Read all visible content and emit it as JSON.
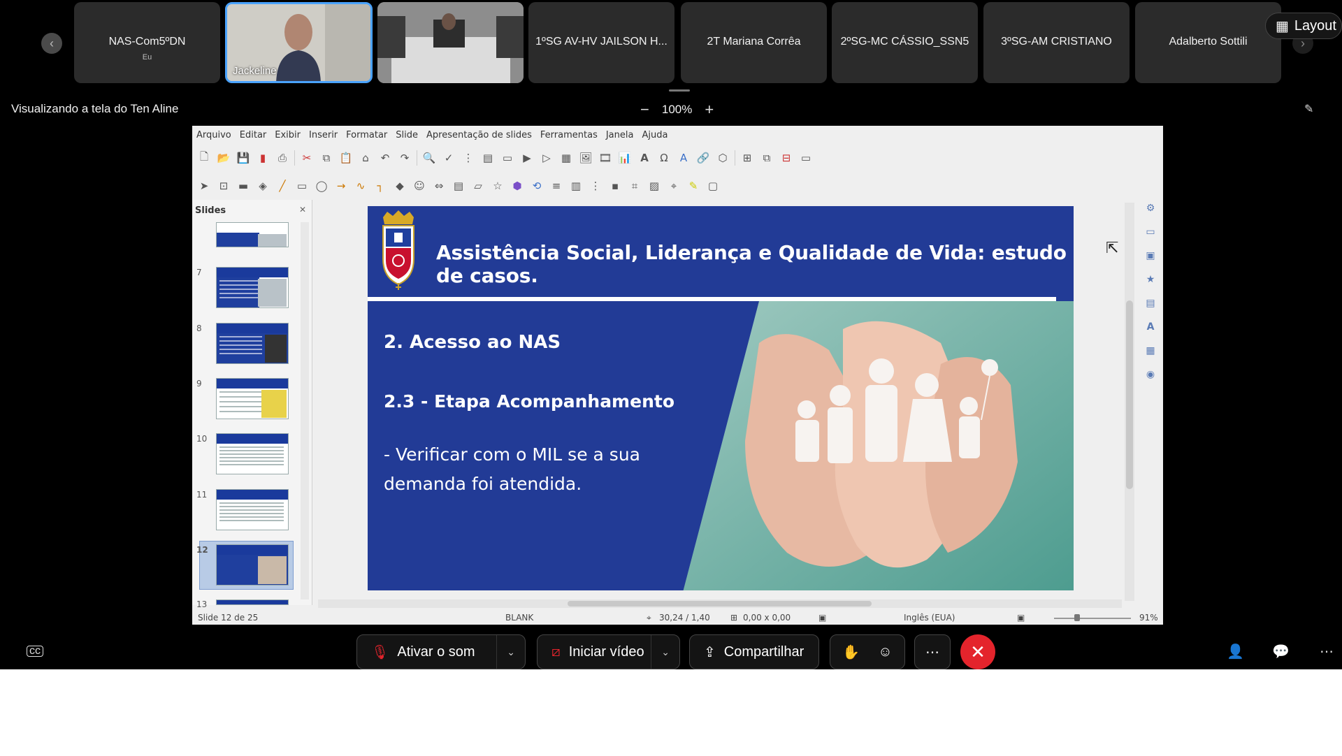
{
  "participants": [
    {
      "name": "NAS-Com5ºDN",
      "sub": "Eu"
    },
    {
      "label": "Jackeline"
    },
    {
      "label": ""
    },
    {
      "name": "1ºSG AV-HV JAILSON H..."
    },
    {
      "name": "2T Mariana Corrêa"
    },
    {
      "name": "2ºSG-MC CÁSSIO_SSN5"
    },
    {
      "name": "3ºSG-AM CRISTIANO"
    },
    {
      "name": "Adalberto Sottili"
    }
  ],
  "layout_label": "Layout",
  "viewing_text": "Visualizando a tela do Ten Aline",
  "zoom": {
    "minus": "−",
    "value": "100%",
    "plus": "+"
  },
  "impress": {
    "menu": [
      "Arquivo",
      "Editar",
      "Exibir",
      "Inserir",
      "Formatar",
      "Slide",
      "Apresentação de slides",
      "Ferramentas",
      "Janela",
      "Ajuda"
    ],
    "slides_pane_title": "Slides",
    "thumbnails": [
      "7",
      "8",
      "9",
      "10",
      "11",
      "12",
      "13"
    ],
    "selected_slide": "12",
    "slide": {
      "title": "Assistência Social, Liderança e Qualidade de Vida: estudo de casos.",
      "heading": "2. Acesso ao NAS",
      "subheading": "2.3 - Etapa Acompanhamento",
      "body": "- Verificar com o MIL se a sua demanda foi atendida."
    },
    "status": {
      "slide_of": "Slide 12 de 25",
      "layout": "BLANK",
      "position": "30,24 / 1,40",
      "size": "0,00 x 0,00",
      "language": "Inglês (EUA)",
      "zoom": "91%"
    }
  },
  "controls": {
    "mute": "Ativar o som",
    "video": "Iniciar vídeo",
    "share": "Compartilhar"
  },
  "colors": {
    "accent": "#4aa3ff",
    "end_call": "#e4242c",
    "slide_blue": "#223b96"
  }
}
